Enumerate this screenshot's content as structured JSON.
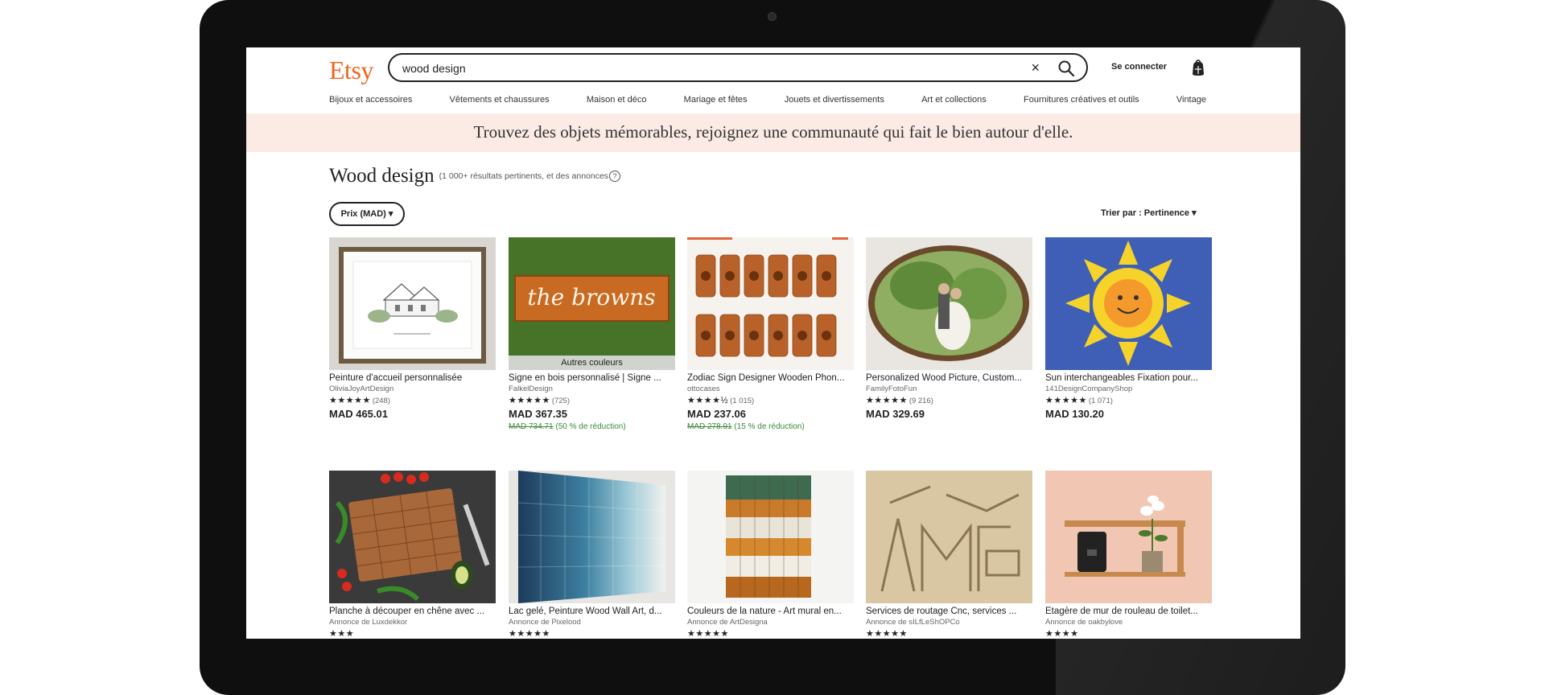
{
  "header": {
    "logo": "Etsy",
    "search_value": "wood design",
    "clear_symbol": "×",
    "sign_in": "Se connecter",
    "icons": [
      "search-icon",
      "close-icon",
      "cart-icon"
    ]
  },
  "nav": {
    "items": [
      "Bijoux et accessoires",
      "Vêtements et chaussures",
      "Maison et déco",
      "Mariage et fêtes",
      "Jouets et divertissements",
      "Art et collections",
      "Fournitures créatives et outils",
      "Vintage"
    ]
  },
  "banner": {
    "text": "Trouvez des objets mémorables, rejoignez une communauté qui fait le bien autour d'elle."
  },
  "results": {
    "title": "Wood design",
    "count": "(1 000+ résultats pertinents, et des annonces",
    "info_symbol": "?",
    "price_filter": "Prix (MAD) ▾",
    "sort": "Trier par : Pertinence ▾"
  },
  "colors": {
    "brand": "#F1641E",
    "banner_bg": "#FCEBE5",
    "discount_green": "#3a8a3a"
  },
  "products": [
    {
      "title": "Peinture d'accueil personnalisée",
      "shop": "OliviaJoyArtDesign",
      "stars": "★★★★★",
      "reviews": "(248)",
      "price": "MAD 465.01"
    },
    {
      "title": "Signe en bois personnalisé | Signe ...",
      "shop": "FalkelDesign",
      "stars": "★★★★★",
      "reviews": "(725)",
      "price": "MAD 367.35",
      "old_price": "MAD 734.71",
      "discount": "(50 % de réduction)",
      "badge": "Autres couleurs",
      "sign_text": "the browns"
    },
    {
      "title": "Zodiac Sign Designer Wooden Phon...",
      "shop": "ottocases",
      "stars": "★★★★½",
      "reviews": "(1 015)",
      "price": "MAD 237.06",
      "old_price": "MAD 278.91",
      "discount": "(15 % de réduction)"
    },
    {
      "title": "Personalized Wood Picture, Custom...",
      "shop": "FamilyFotoFun",
      "stars": "★★★★★",
      "reviews": "(9 216)",
      "price": "MAD 329.69"
    },
    {
      "title": "Sun interchangeables Fixation pour...",
      "shop": "141DesignCompanyShop",
      "stars": "★★★★★",
      "reviews": "(1 071)",
      "price": "MAD 130.20"
    },
    {
      "title": "Planche à découper en chêne avec ...",
      "shop": "Annonce de Luxdekkor",
      "stars": "★★★"
    },
    {
      "title": "Lac gelé, Peinture Wood Wall Art, d...",
      "shop": "Annonce de Pixelood",
      "stars": "★★★★★"
    },
    {
      "title": "Couleurs de la nature - Art mural en...",
      "shop": "Annonce de ArtDesigna",
      "stars": "★★★★★"
    },
    {
      "title": "Services de routage Cnc, services ...",
      "shop": "Annonce de sILfLeShOPCo",
      "stars": "★★★★★"
    },
    {
      "title": "Étagère de mur de rouleau de toilet...",
      "shop": "Annonce de oakbylove",
      "stars": "★★★★"
    }
  ]
}
